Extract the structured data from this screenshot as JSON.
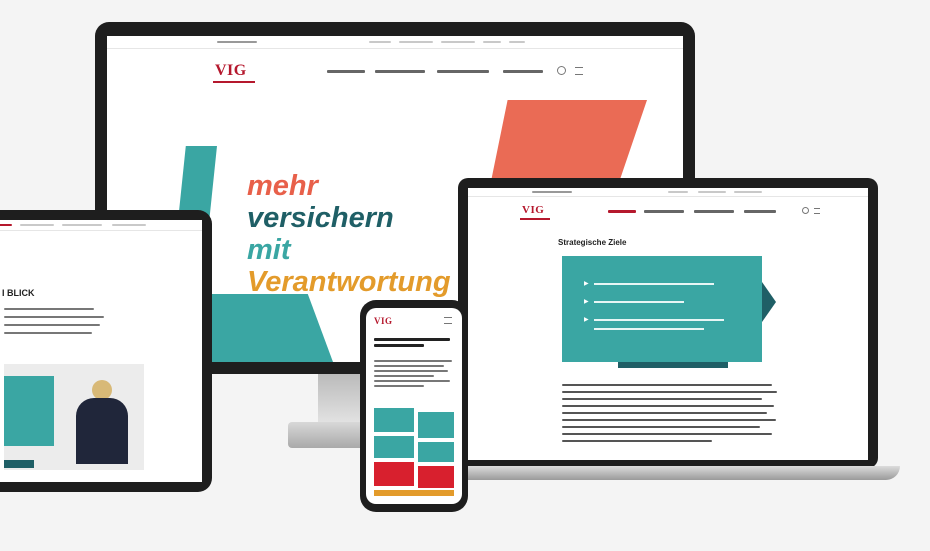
{
  "desktop": {
    "logo": "VIG",
    "slogan_line1": "mehr",
    "slogan_line2": "versichern",
    "slogan_line3": "mit",
    "slogan_line4": "Verantwortung",
    "colors": {
      "line1": "#e8604a",
      "line2": "#1f5f66",
      "line3": "#3aa6a3",
      "line4": "#e39b2b"
    }
  },
  "laptop": {
    "logo": "VIG",
    "heading": "Strategische Ziele"
  },
  "tablet": {
    "heading": "I BLICK"
  },
  "phone": {
    "logo": "VIG"
  },
  "icons": {
    "bullet": "play-triangle-icon",
    "search": "search-icon",
    "menu": "hamburger-icon"
  }
}
